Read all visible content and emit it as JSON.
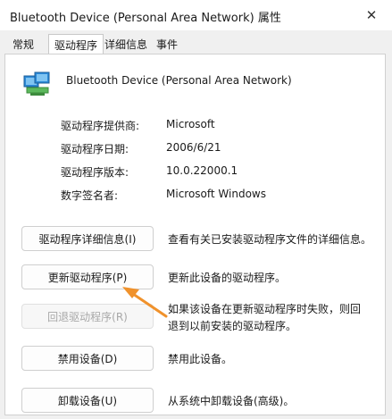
{
  "window": {
    "title": "Bluetooth Device (Personal Area Network) 属性",
    "close_glyph": "✕"
  },
  "tabs": [
    {
      "label": "常规"
    },
    {
      "label": "驱动程序",
      "active": true
    },
    {
      "label": "详细信息"
    },
    {
      "label": "事件"
    }
  ],
  "device": {
    "name": "Bluetooth Device (Personal Area Network)",
    "icon": "network-adapter-icon"
  },
  "info": [
    {
      "label": "驱动程序提供商:",
      "value": "Microsoft"
    },
    {
      "label": "驱动程序日期:",
      "value": "2006/6/21"
    },
    {
      "label": "驱动程序版本:",
      "value": "10.0.22000.1"
    },
    {
      "label": "数字签名者:",
      "value": "Microsoft Windows"
    }
  ],
  "actions": [
    {
      "button": "驱动程序详细信息(I)",
      "description": "查看有关已安装驱动程序文件的详细信息。",
      "enabled": true
    },
    {
      "button": "更新驱动程序(P)",
      "description": "更新此设备的驱动程序。",
      "enabled": true
    },
    {
      "button": "回退驱动程序(R)",
      "description": "如果该设备在更新驱动程序时失败，则回退到以前安装的驱动程序。",
      "enabled": false
    },
    {
      "button": "禁用设备(D)",
      "description": "禁用此设备。",
      "enabled": true
    },
    {
      "button": "卸载设备(U)",
      "description": "从系统中卸载设备(高级)。",
      "enabled": true
    }
  ],
  "colors": {
    "annotation_arrow": "#f0922c",
    "icon_blue": "#2b8ad8",
    "icon_green": "#5cb85c"
  }
}
